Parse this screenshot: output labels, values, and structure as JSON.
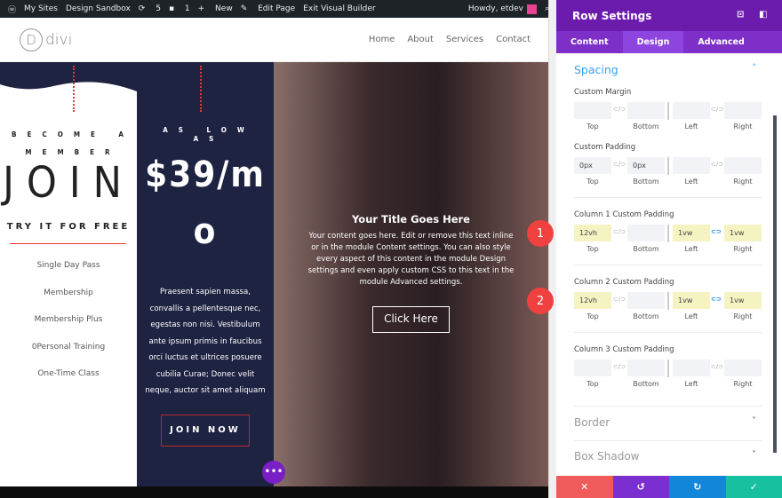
{
  "adminbar": {
    "items": [
      "My Sites",
      "Design Sandbox",
      "5",
      "1",
      "New",
      "Edit Page",
      "Exit Visual Builder"
    ],
    "howdy": "Howdy, etdev"
  },
  "site": {
    "logo": "divi",
    "logo_letter": "D",
    "nav": [
      "Home",
      "About",
      "Services",
      "Contact"
    ]
  },
  "col1": {
    "eyebrow": "BECOME A MEMBER",
    "title": "JOIN",
    "cta": "TRY IT FOR FREE",
    "items": [
      "Single Day Pass",
      "Membership",
      "Membership Plus",
      "0Personal Training",
      "One-Time Class"
    ]
  },
  "col2": {
    "eyebrow": "AS LOW AS",
    "price": "$39/mo",
    "body": "Praesent sapien massa, convallis a pellentesque nec, egestas non nisi. Vestibulum ante ipsum primis in faucibus orci luctus et ultrices posuere cubilia Curae; Donec velit neque, auctor sit amet aliquam",
    "button": "JOIN NOW"
  },
  "col3": {
    "title": "Your Title Goes Here",
    "body": "Your content goes here. Edit or remove this text inline or in the module Content settings. You can also style every aspect of this content in the module Design settings and even apply custom CSS to this text in the module Advanced settings.",
    "button": "Click Here"
  },
  "panel": {
    "title": "Row Settings",
    "tabs": [
      "Content",
      "Design",
      "Advanced"
    ],
    "active_tab": "Design",
    "section": "Spacing",
    "sides": [
      "Top",
      "Bottom",
      "Left",
      "Right"
    ],
    "groups": [
      {
        "label": "Custom Margin",
        "values": [
          "",
          "",
          "",
          ""
        ]
      },
      {
        "label": "Custom Padding",
        "values": [
          "0px",
          "0px",
          "",
          ""
        ]
      },
      {
        "label": "Column 1 Custom Padding",
        "values": [
          "12vh",
          "",
          "1vw",
          "1vw"
        ],
        "badge": "1"
      },
      {
        "label": "Column 2 Custom Padding",
        "values": [
          "12vh",
          "",
          "1vw",
          "1vw"
        ],
        "badge": "2"
      },
      {
        "label": "Column 3 Custom Padding",
        "values": [
          "",
          "",
          "",
          ""
        ]
      }
    ],
    "collapsed": [
      "Border",
      "Box Shadow"
    ]
  },
  "colors": {
    "purple": "#6c1cad",
    "navy": "#1f2342",
    "cancel": "#ef5b5b",
    "undo": "#7b2fd0",
    "redo": "#1287d9",
    "save": "#17c0a0",
    "highlight": "#f5f3c1"
  }
}
